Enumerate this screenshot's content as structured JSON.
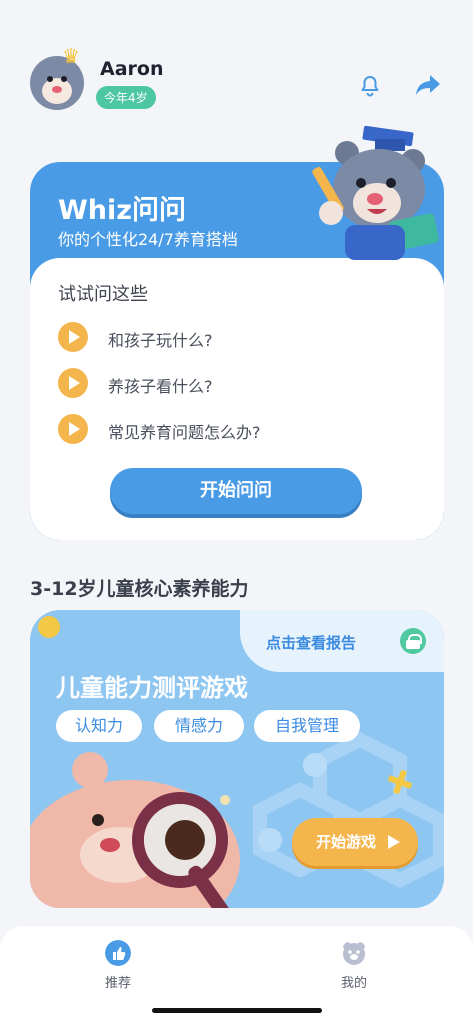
{
  "header": {
    "username": "Aaron",
    "age_badge": "今年4岁",
    "icons": [
      "bell-icon",
      "share-icon"
    ]
  },
  "whiz": {
    "title": "Whiz问问",
    "subtitle": "你的个性化24/7养育搭档",
    "try_title": "试试问这些",
    "questions": [
      "和孩子玩什么?",
      "养孩子看什么?",
      "常见养育问题怎么办?"
    ],
    "start_label": "开始问问"
  },
  "section": {
    "title": "3-12岁儿童核心素养能力"
  },
  "eval": {
    "report_label": "点击查看报告",
    "title": "儿童能力测评游戏",
    "chips": [
      "认知力",
      "情感力",
      "自我管理"
    ],
    "game_label": "开始游戏"
  },
  "nav": {
    "items": [
      {
        "label": "推荐",
        "icon": "thumbs-up-icon",
        "active": true
      },
      {
        "label": "我的",
        "icon": "bear-face-icon",
        "active": false
      }
    ]
  },
  "colors": {
    "primary_blue": "#4a9be6",
    "orange": "#f5b54d",
    "green": "#4cc7a2",
    "light_blue": "#8ec6f2"
  }
}
